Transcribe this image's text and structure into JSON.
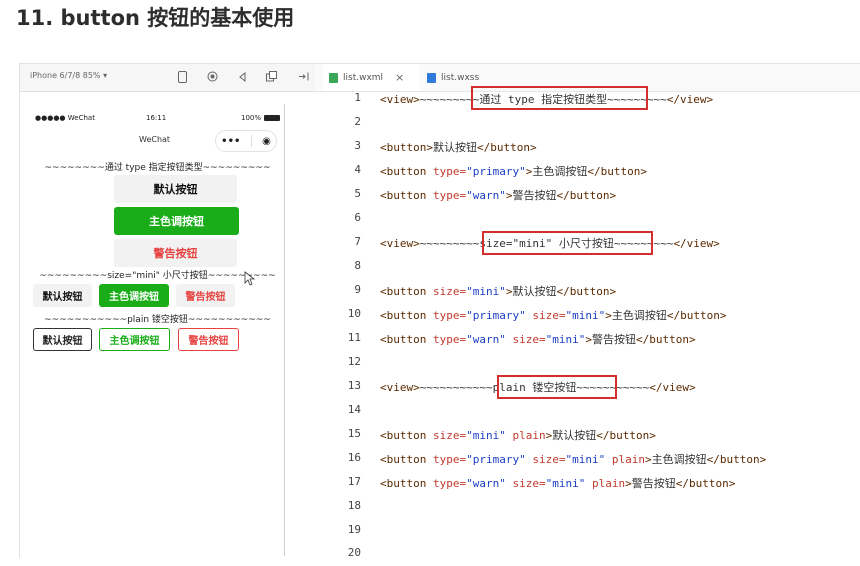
{
  "heading": "11. button 按钮的基本使用",
  "simulator": {
    "device": "iPhone 6/7/8 85% ▾",
    "status": {
      "signal": "●●●●● WeChat",
      "time": "16:11",
      "battery": "100%"
    },
    "nav_title": "WeChat",
    "capsule": {
      "more": "•••",
      "close": "◉"
    },
    "view1": "~~~~~~~~通过 type 指定按钮类型~~~~~~~~~",
    "buttons_normal": {
      "default": "默认按钮",
      "primary": "主色调按钮",
      "warn": "警告按钮"
    },
    "view2": "~~~~~~~~~size=\"mini\" 小尺寸按钮~~~~~~~~~",
    "buttons_mini": {
      "default": "默认按钮",
      "primary": "主色调按钮",
      "warn": "警告按钮"
    },
    "view3": "~~~~~~~~~~~plain 镂空按钮~~~~~~~~~~~",
    "buttons_plain": {
      "default": "默认按钮",
      "primary": "主色调按钮",
      "warn": "警告按钮"
    }
  },
  "editor": {
    "tabs": [
      {
        "label": "list.wxml",
        "close": "×"
      },
      {
        "label": "list.wxss"
      }
    ],
    "line_numbers": [
      "1",
      "2",
      "3",
      "4",
      "5",
      "6",
      "7",
      "8",
      "9",
      "10",
      "11",
      "12",
      "13",
      "14",
      "15",
      "16",
      "17",
      "18",
      "19",
      "20"
    ],
    "lines": {
      "l1": {
        "open": "<view>",
        "tilde_a": "~~~~~~~~",
        "boxed": "~通过 type 指定按钮类型~",
        "tilde_b": "~~~~~~~~",
        "close": "</view>"
      },
      "l3": {
        "open": "<button>",
        "text": "默认按钮",
        "close": "</button>"
      },
      "l4": {
        "open": "<button ",
        "attr": "type=",
        "val": "\"primary\"",
        "gt": ">",
        "text": "主色调按钮",
        "close": "</button>"
      },
      "l5": {
        "open": "<button ",
        "attr": "type=",
        "val": "\"warn\"",
        "gt": ">",
        "text": "警告按钮",
        "close": "</button>"
      },
      "l7": {
        "open": "<view>",
        "tilde_a": "~~~~~~~~",
        "boxed": "~size=\"mini\" 小尺寸按钮~",
        "tilde_b": "~~~~~~~~",
        "close": "</view>"
      },
      "l9": {
        "open": "<button ",
        "attr": "size=",
        "val": "\"mini\"",
        "gt": ">",
        "text": "默认按钮",
        "close": "</button>"
      },
      "l10": {
        "open": "<button ",
        "attr1": "type=",
        "val1": "\"primary\"",
        "attr2": " size=",
        "val2": "\"mini\"",
        "gt": ">",
        "text": "主色调按钮",
        "close": "</button>"
      },
      "l11": {
        "open": "<button ",
        "attr1": "type=",
        "val1": "\"warn\"",
        "attr2": " size=",
        "val2": "\"mini\"",
        "gt": ">",
        "text": "警告按钮",
        "close": "</button>"
      },
      "l13": {
        "open": "<view>",
        "tilde_a": "~~~~~~~~~~",
        "boxed": "~plain 镂空按钮~",
        "tilde_b": "~~~~~~~~~~",
        "close": "</view>"
      },
      "l15": {
        "open": "<button ",
        "attr": "size=",
        "val": "\"mini\"",
        "kw": " plain",
        "gt": ">",
        "text": "默认按钮",
        "close": "</button>"
      },
      "l16": {
        "open": "<button ",
        "attr1": "type=",
        "val1": "\"primary\"",
        "attr2": " size=",
        "val2": "\"mini\"",
        "kw": " plain",
        "gt": ">",
        "text": "主色调按钮",
        "close": "</button>"
      },
      "l17": {
        "open": "<button ",
        "attr1": "type=",
        "val1": "\"warn\"",
        "attr2": " size=",
        "val2": "\"mini\"",
        "kw": " plain",
        "gt": ">",
        "text": "警告按钮",
        "close": "</button>"
      }
    }
  },
  "colors": {
    "primary_green": "#1aad19",
    "warn_red": "#e64340",
    "highlight_red": "#d32f2f"
  }
}
